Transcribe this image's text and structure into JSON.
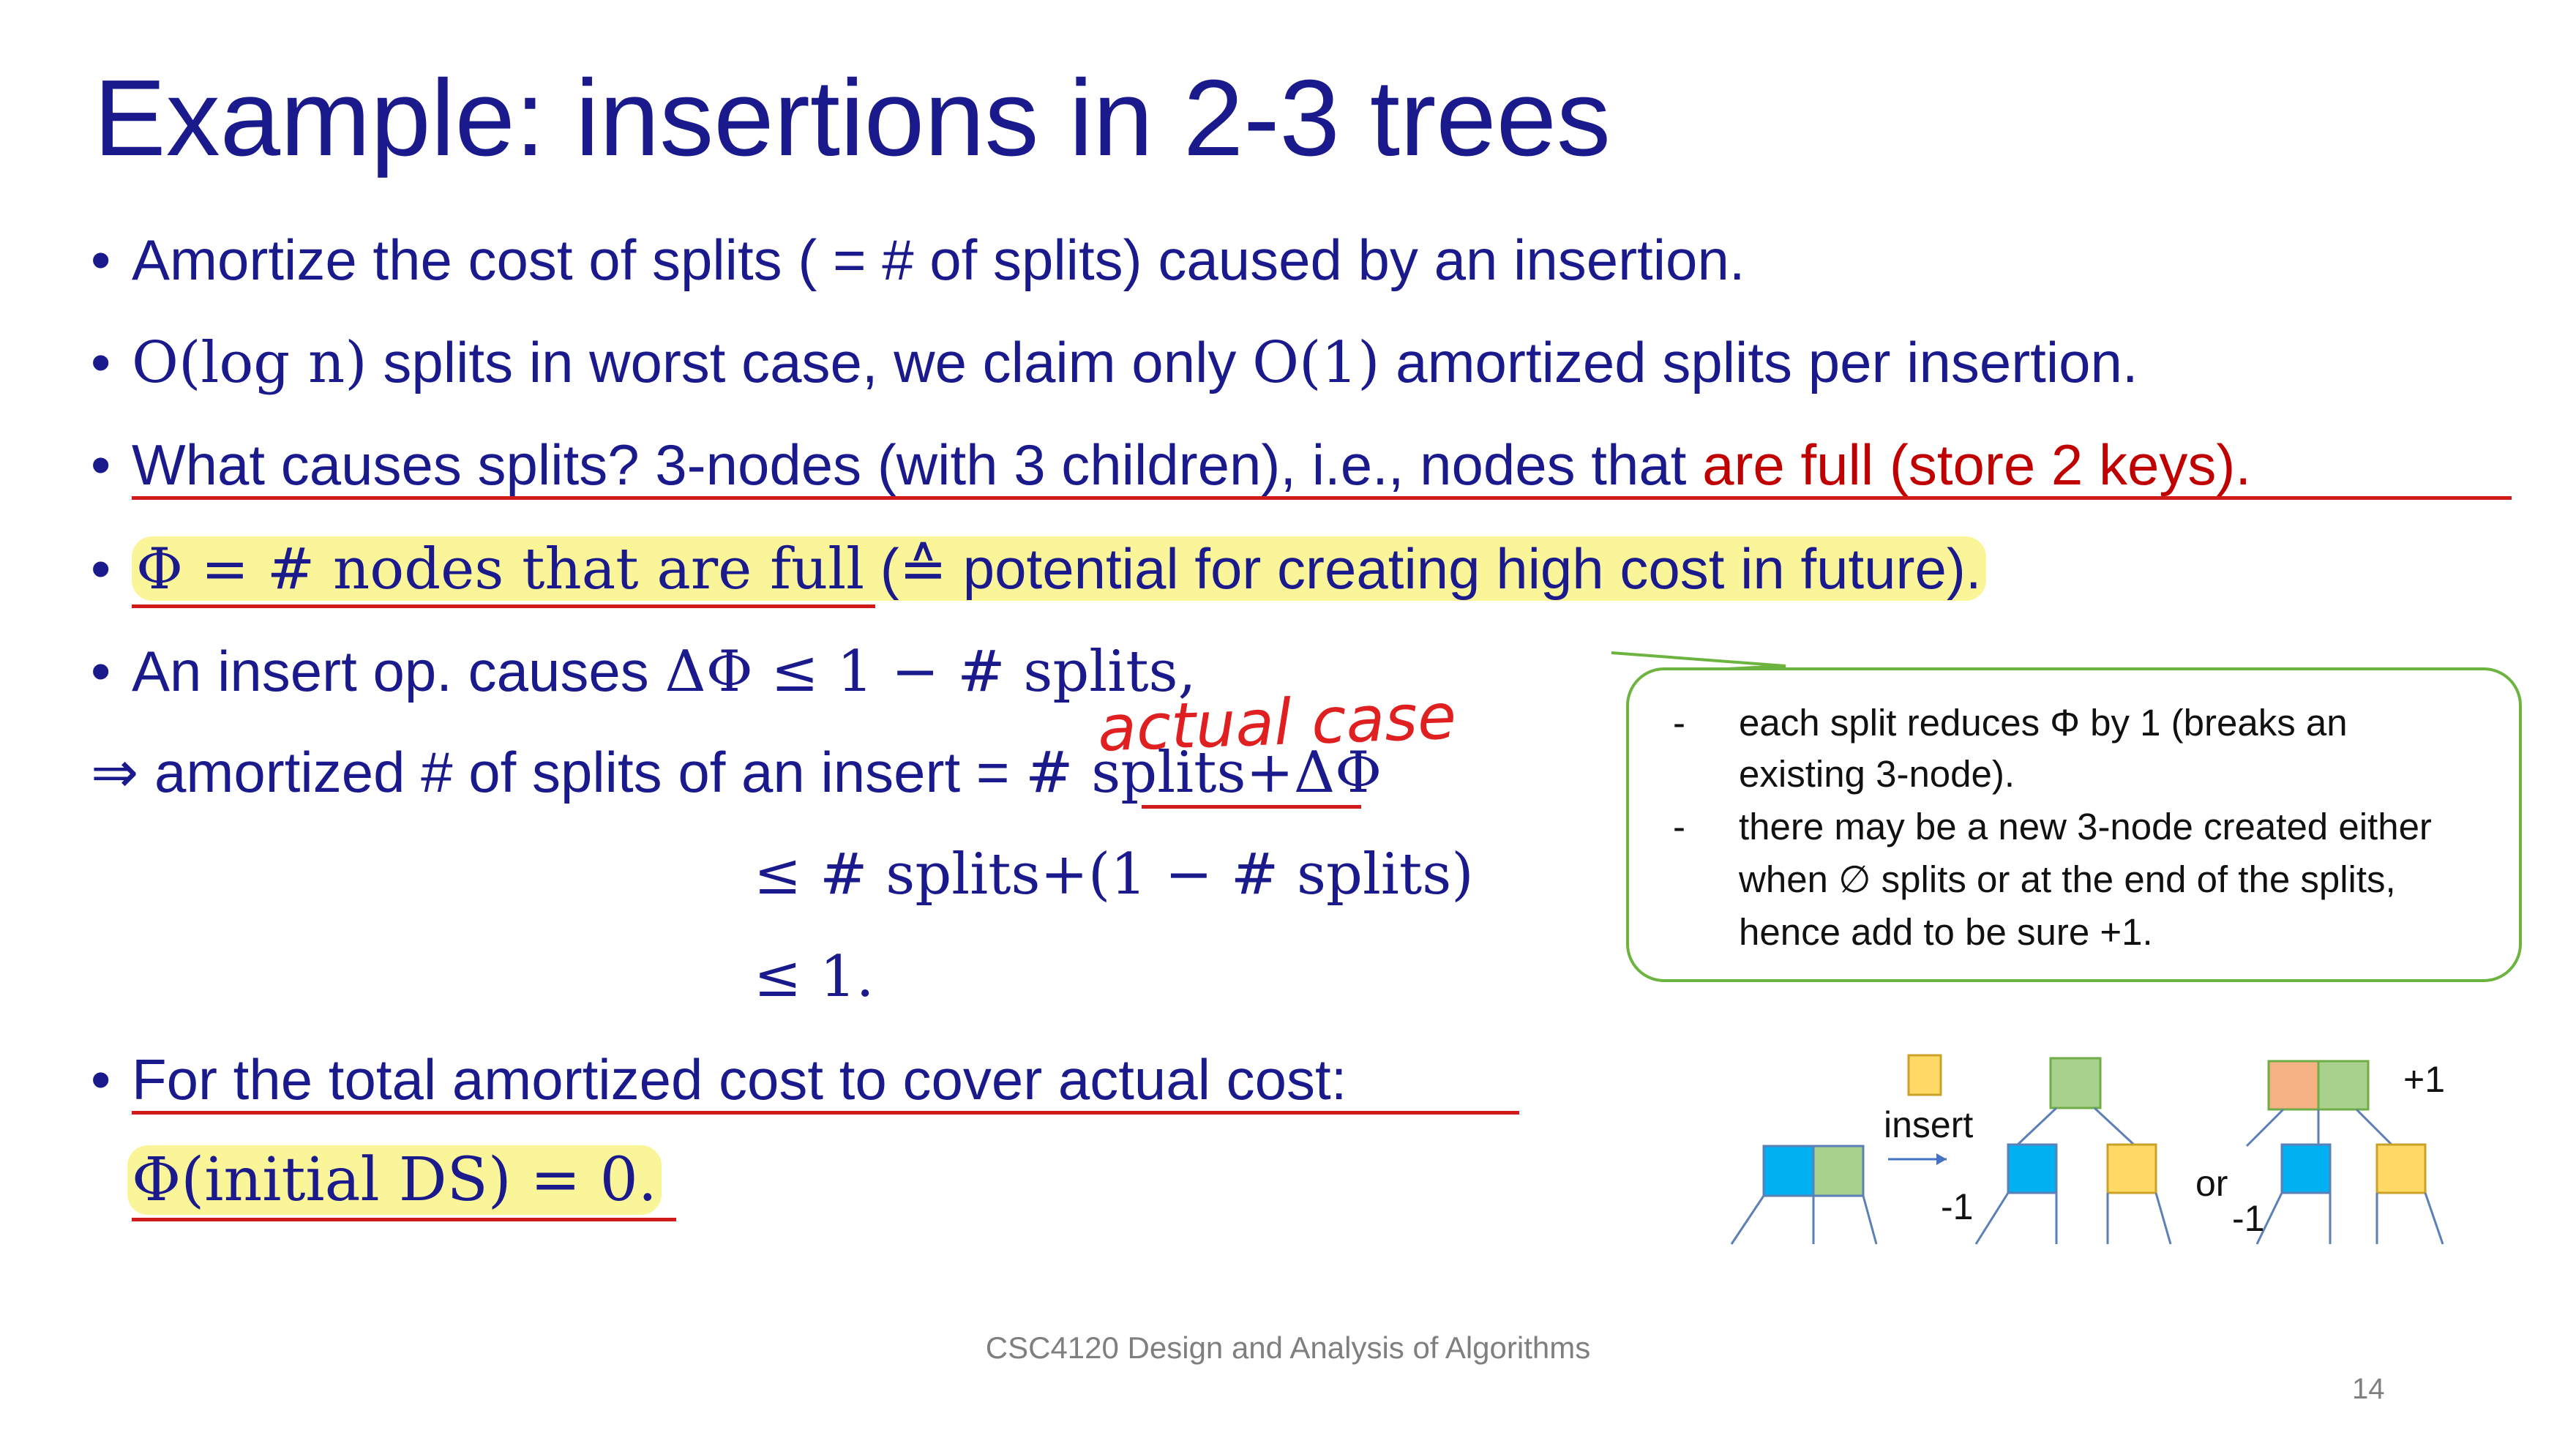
{
  "slide": {
    "title": "Example: insertions in 2-3 trees",
    "bullets": {
      "b1": "Amortize the cost of splits ( = # of splits) caused by an insertion.",
      "b2_math1": "O(log n)",
      "b2_text1": " splits in worst case, we claim only ",
      "b2_math2": "O(1)",
      "b2_text2": " amortized splits per insertion.",
      "b3_blue": "What causes splits? 3-nodes (with 3 children), i.e., nodes that ",
      "b3_red": "are full (store 2 keys).",
      "b4_math": "Φ = # nodes that are full",
      "b4_text": " (≙ potential for creating high cost in future).",
      "b5_text": "An insert op. causes ",
      "b5_math": "ΔΦ ≤ 1 − # splits,",
      "l6_text": "⇒ amortized # of splits of an insert = ",
      "l6_math": "# splits+ΔΦ",
      "l7_math": "≤ # splits+(1 − # splits)",
      "l8_math": "≤ 1.",
      "b9": "For the total amortized cost to cover actual cost:",
      "b10_math": "Φ(initial DS) = 0."
    },
    "annotation": "actual case",
    "note": {
      "dash": "-",
      "line1": "each split reduces Φ by 1 (breaks an",
      "line2": "existing 3-node).",
      "line3": "there may be a new  3-node created either",
      "line4": "when ∅ splits or at the end of the splits,",
      "line5": "hence add to be sure +1."
    },
    "diagram": {
      "insert_label": "insert",
      "minus_one_a": "-1",
      "or_label": "or",
      "minus_one_b": "-1",
      "plus_one": "+1"
    },
    "footer": "CSC4120 Design and Analysis of Algorithms",
    "page_number": "14",
    "colors": {
      "title_blue": "#1a1a8c",
      "red_text": "#c00000",
      "highlight": "#fbf59a",
      "note_border": "#6db33f",
      "node_blue": "#00b0f0",
      "node_green": "#a9d18e",
      "node_yellow": "#ffd966",
      "node_orange": "#f4b183",
      "edge_blue": "#5b7fb7"
    }
  }
}
